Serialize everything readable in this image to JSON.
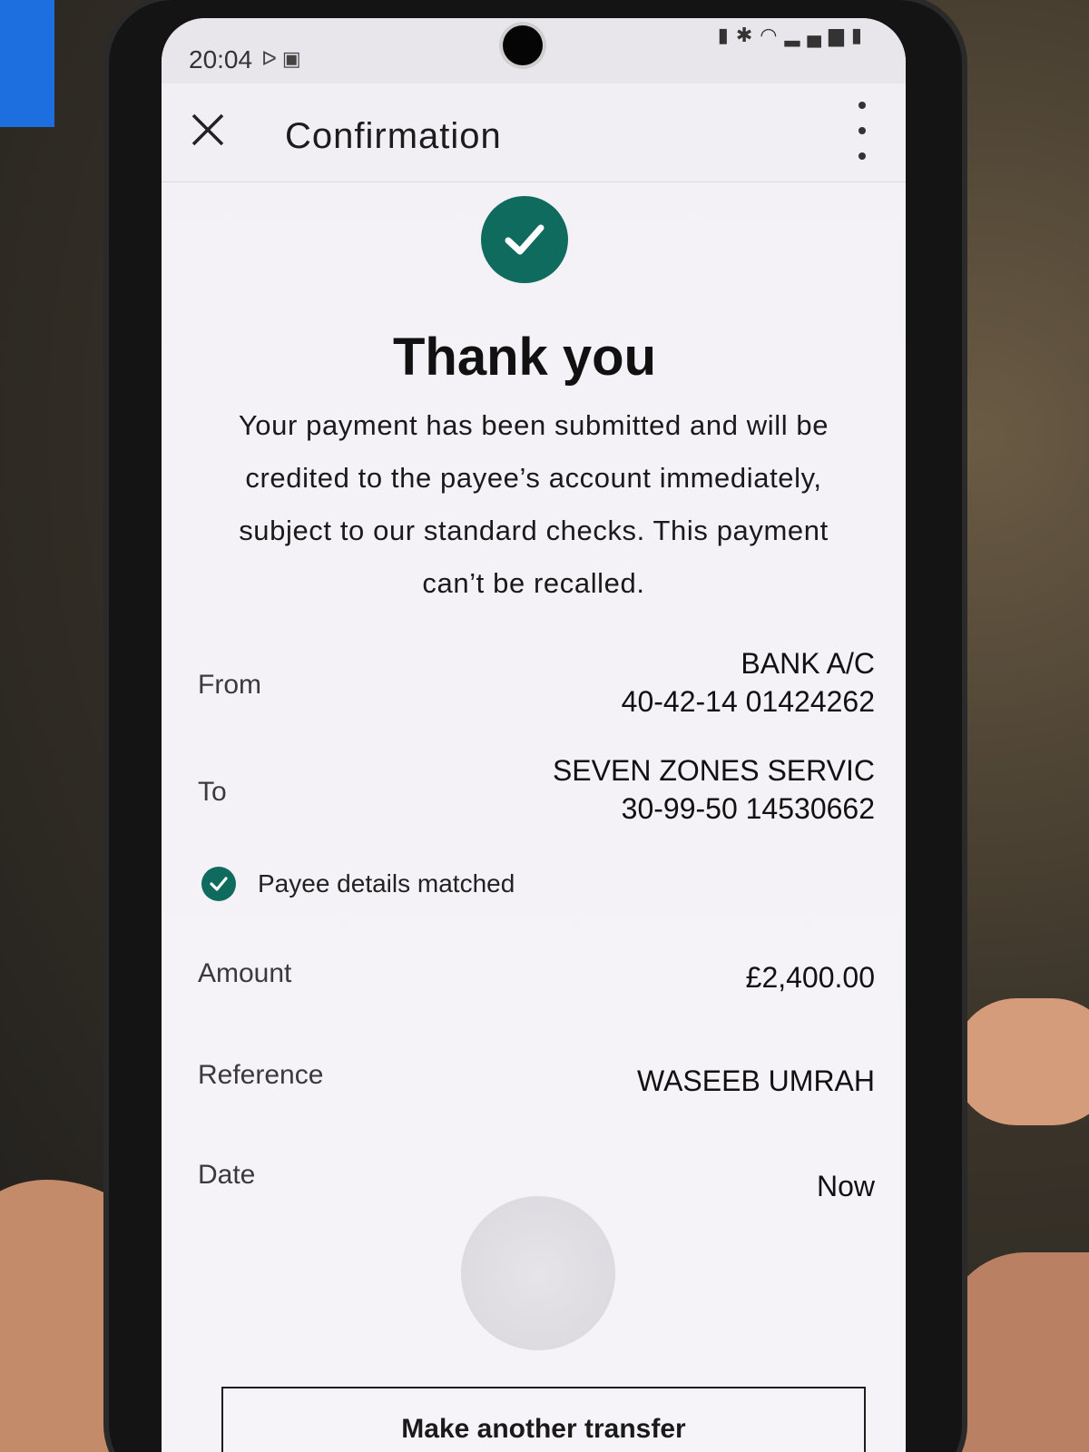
{
  "status_bar": {
    "time": "20:04",
    "left_icons": [
      "playstation-icon",
      "calendar-icon"
    ],
    "right_icons": [
      "lock-icon",
      "bluetooth-icon",
      "wifi-icon",
      "signal-icon",
      "battery-icon"
    ]
  },
  "app_bar": {
    "title": "Confirmation"
  },
  "confirmation": {
    "title": "Thank you",
    "message": "Your payment has been submitted and will be credited to the payee’s account immediately, subject to our standard checks. This payment can’t be recalled."
  },
  "details": {
    "from": {
      "label": "From",
      "line1": "BANK A/C",
      "line2": "40-42-14 01424262"
    },
    "to": {
      "label": "To",
      "line1": "SEVEN ZONES SERVIC",
      "line2": "30-99-50 14530662"
    },
    "payee_check": "Payee details matched",
    "amount": {
      "label": "Amount",
      "value": "£2,400.00"
    },
    "reference": {
      "label": "Reference",
      "value": "WASEEB UMRAH"
    },
    "date": {
      "label": "Date",
      "value": "Now"
    }
  },
  "actions": {
    "make_another_transfer": "Make another transfer"
  },
  "colors": {
    "accent": "#0e6b5e",
    "background": "#f4f2f7",
    "text": "#111111"
  }
}
